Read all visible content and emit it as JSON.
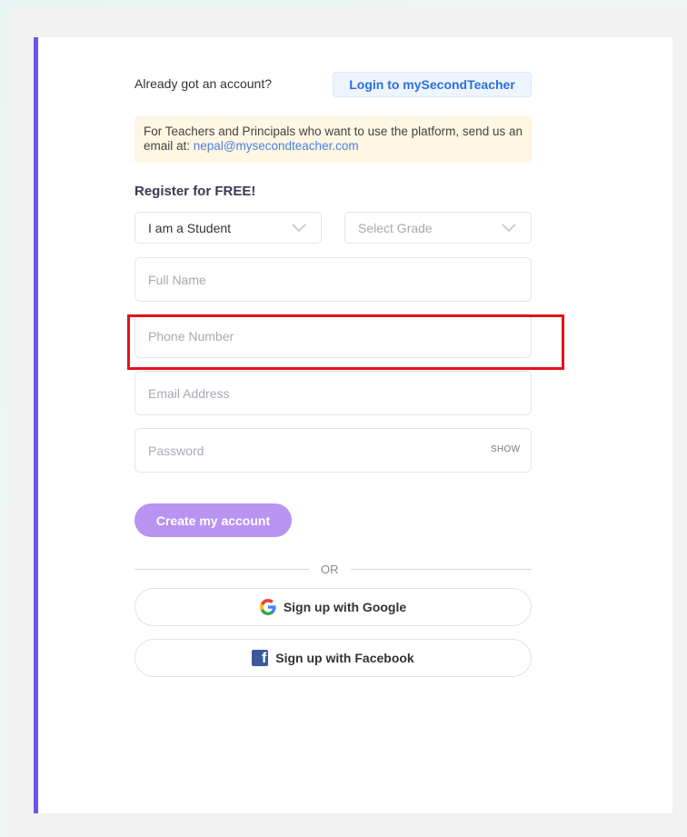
{
  "login": {
    "prompt": "Already got an account?",
    "button_label": "Login to mySecondTeacher"
  },
  "info": {
    "text": "For Teachers and Principals who want to use the platform, send us an email at: ",
    "email": "nepal@mysecondteacher.com"
  },
  "register": {
    "title": "Register for FREE!",
    "role_select": {
      "value": "I am a Student"
    },
    "grade_select": {
      "value": "Select Grade"
    },
    "full_name": {
      "placeholder": "Full Name"
    },
    "phone": {
      "placeholder": "Phone Number"
    },
    "email": {
      "placeholder": "Email Address"
    },
    "password": {
      "placeholder": "Password",
      "toggle_label": "SHOW"
    },
    "create_label": "Create my account",
    "or_label": "OR",
    "google_label": "Sign up with Google",
    "facebook_label": "Sign up with Facebook"
  },
  "icons": {
    "google": "google-icon",
    "facebook": "facebook-icon",
    "chevron": "chevron-down-icon"
  },
  "colors": {
    "accent_bar": "#6e56e8",
    "primary_button": "#b893f2",
    "link": "#2a6fe0",
    "info_bg": "#fff6e3",
    "highlight": "#e3131b"
  }
}
